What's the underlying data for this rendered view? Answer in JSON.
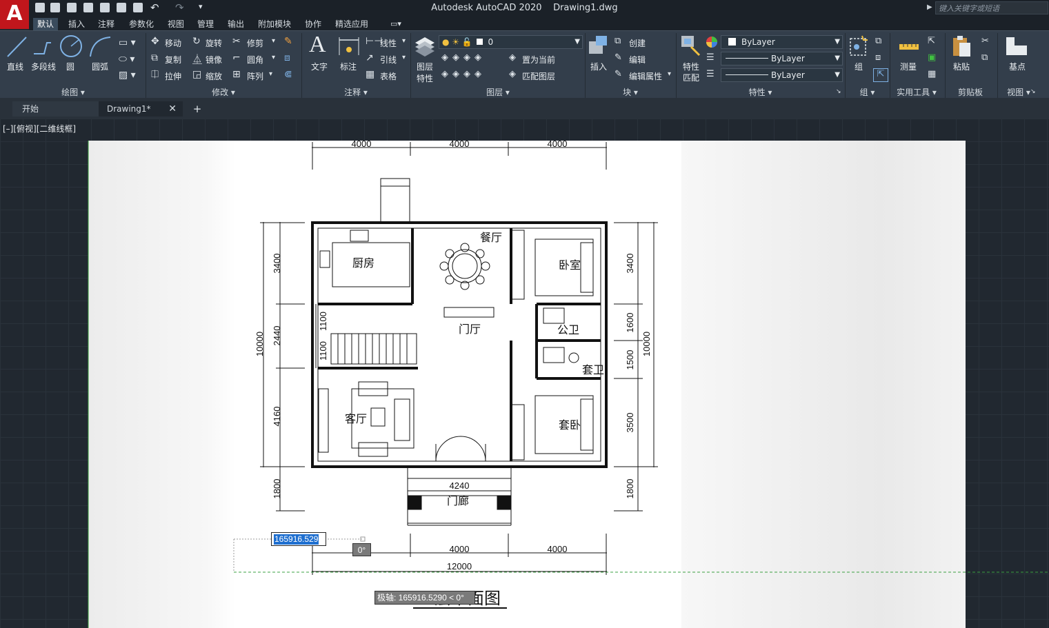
{
  "title_bar": {
    "app_title": "Autodesk AutoCAD 2020",
    "file_name": "Drawing1.dwg",
    "search_placeholder": "键入关键字或短语",
    "app_logo_letter": "A"
  },
  "menu_tabs": [
    "默认",
    "插入",
    "注释",
    "参数化",
    "视图",
    "管理",
    "输出",
    "附加模块",
    "协作",
    "精选应用"
  ],
  "ribbon": {
    "draw": {
      "title": "绘图",
      "line": "直线",
      "polyline": "多段线",
      "circle": "圆",
      "arc": "圆弧"
    },
    "modify": {
      "title": "修改",
      "move": "移动",
      "rotate": "旋转",
      "trim": "修剪",
      "copy": "复制",
      "mirror": "镜像",
      "fillet": "圆角",
      "stretch": "拉伸",
      "scale": "缩放",
      "array": "阵列"
    },
    "annotation": {
      "title": "注释",
      "text": "文字",
      "dimension": "标注",
      "linear": "线性",
      "leader": "引线",
      "table": "表格"
    },
    "layers": {
      "title": "图层",
      "layer_properties_1": "图层",
      "layer_properties_2": "特性",
      "current_layer": "0",
      "set_current": "置为当前",
      "match_layer": "匹配图层"
    },
    "block": {
      "title": "块",
      "insert": "插入",
      "create": "创建",
      "edit": "编辑",
      "edit_attributes": "编辑属性"
    },
    "properties": {
      "title": "特性",
      "match_1": "特性",
      "match_2": "匹配",
      "color": "ByLayer",
      "linetype": "ByLayer",
      "lineweight": "ByLayer"
    },
    "groups": {
      "title": "组",
      "group": "组"
    },
    "utilities": {
      "title": "实用工具",
      "measure": "测量"
    },
    "clipboard": {
      "title": "剪贴板",
      "paste": "粘贴"
    },
    "view": {
      "title": "视图",
      "base": "基点"
    }
  },
  "doc_tabs": {
    "start": "开始",
    "drawing": "Drawing1*"
  },
  "viewport_label": "[–][俯视][二维线框]",
  "plan": {
    "top_dims": [
      "4000",
      "4000",
      "4000"
    ],
    "left_dims": [
      "3400",
      "2440",
      "4160",
      "1800"
    ],
    "left_total": "10000",
    "stair_dims": [
      "1100",
      "1100"
    ],
    "right_dims": [
      "3400",
      "1600",
      "1500",
      "3500",
      "1800"
    ],
    "right_total": "10000",
    "porch_dim": "4240",
    "bottom_dims": [
      "4000",
      "4000"
    ],
    "bottom_total": "12000",
    "rooms": {
      "kitchen": "厨房",
      "dining": "餐厅",
      "bedroom": "卧室",
      "public_bath": "公卫",
      "suite_bath": "套卫",
      "suite_bedroom": "套卧",
      "living": "客厅",
      "hall": "门厅",
      "porch": "门廊"
    },
    "drawing_title": "一层平面图"
  },
  "command_input": {
    "value": "165916.529",
    "angle": "0°",
    "polar_tooltip": "极轴: 165916.5290 < 0°"
  },
  "colors": {
    "ribbon_bg": "#333e4b",
    "canvas_bg": "#212830",
    "logo_red": "#c0161c",
    "selection_blue": "#1e6fd0"
  }
}
